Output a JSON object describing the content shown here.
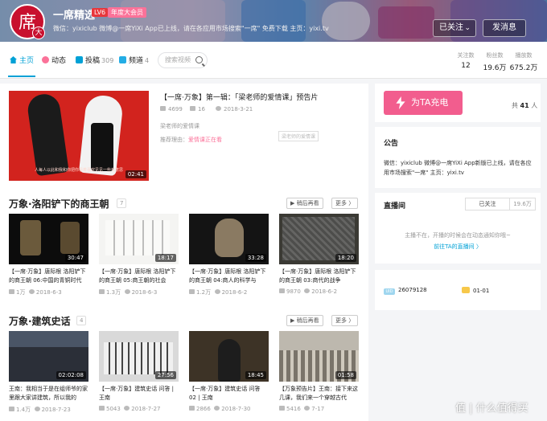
{
  "header": {
    "avatar_char": "席",
    "avatar_badge": "大",
    "username": "一席精选",
    "level": "LV6",
    "vip": "年度大会员",
    "signature": "微信：yixiclub 微博@一席YiXi App已上线，请在各应用市场搜索\"一席\" 免费下载 主页：yixi.tv",
    "follow_label": "已关注",
    "message_label": "发消息"
  },
  "nav": {
    "tabs": [
      {
        "label": "主页",
        "count": ""
      },
      {
        "label": "动态",
        "count": ""
      },
      {
        "label": "投稿",
        "count": "309"
      },
      {
        "label": "频道",
        "count": "4"
      }
    ],
    "search_placeholder": "搜索视频",
    "stats": [
      {
        "label": "关注数",
        "value": "12"
      },
      {
        "label": "粉丝数",
        "value": "19.6万"
      },
      {
        "label": "播放数",
        "value": "675.2万"
      }
    ]
  },
  "featured": {
    "title": "【一席·万象】第一辑：「梁老师的爱情课」预告片",
    "duration": "02:41",
    "thumb_caption": "人每人以此和我和你把你看着喜欢见见一些有意思",
    "views": "4699",
    "danmaku": "16",
    "date": "2018-3-21",
    "desc": "梁老师的爱情课",
    "rec_label": "推荐理由：",
    "rec_text": "爱情课正在看",
    "badge": "梁老师的爱情课"
  },
  "sections": [
    {
      "title": "万象·洛阳铲下的商王朝",
      "count": "7",
      "play_label": "稍后再看",
      "more_label": "更多 〉",
      "videos": [
        {
          "duration": "30:47",
          "title": "【一席·万象】唐际根 洛阳铲下的商王朝 06:中国的青铜时代",
          "views": "1万",
          "date": "2018-6-3"
        },
        {
          "duration": "18:17",
          "title": "【一席·万象】唐际根 洛阳铲下的商王朝 05:商王朝的社会",
          "views": "1.3万",
          "date": "2018-6-3"
        },
        {
          "duration": "33:28",
          "title": "【一席·万象】唐际根 洛阳铲下的商王朝 04:商人的科学与",
          "views": "1.2万",
          "date": "2018-6-2"
        },
        {
          "duration": "18:20",
          "title": "【一席·万象】唐际根 洛阳铲下的商王朝 03:商代的战争",
          "views": "9870",
          "date": "2018-6-2"
        }
      ]
    },
    {
      "title": "万象·建筑史话",
      "count": "4",
      "play_label": "稍后再看",
      "more_label": "更多 〉",
      "videos": [
        {
          "duration": "02:02:08",
          "title": "王南：我相当于是在组师爷的家里跟大家讲建筑，所以我的",
          "views": "1.4万",
          "date": "2018-7-23"
        },
        {
          "duration": "27:56",
          "title": "【一席·万象】建筑史话 问答 | 王南",
          "views": "5043",
          "date": "2018-7-27"
        },
        {
          "duration": "18:45",
          "title": "【一席·万象】建筑史话 问答 02 | 王南",
          "views": "2866",
          "date": "2018-7-30"
        },
        {
          "duration": "01:58",
          "title": "【万象预告片】王南：接下来这几课，我们来一个穿越古代",
          "views": "5416",
          "date": "7-17"
        }
      ]
    }
  ],
  "sidebar": {
    "charge_label": "为TA充电",
    "charge_prefix": "共",
    "charge_count": "41",
    "charge_suffix": "人",
    "notice_title": "公告",
    "notice_text": "微信：yixiclub 微博@一席YiXi App新版已上线，请在各应用市场搜索\"一席\" 主页：yixi.tv",
    "live_title": "直播间",
    "live_follow": "已关注",
    "live_fans": "19.6万",
    "live_off": "主播不在，开播的时候会在动态通知你哦~",
    "live_link": "前往TA的直播间 〉",
    "uid_label": "UID",
    "uid": "26079128",
    "birthday": "01-01"
  },
  "watermark": "值 | 什么值得买",
  "colors": {
    "accent": "#00a1d6",
    "pink": "#fb7299",
    "charge": "#f25d8e"
  }
}
